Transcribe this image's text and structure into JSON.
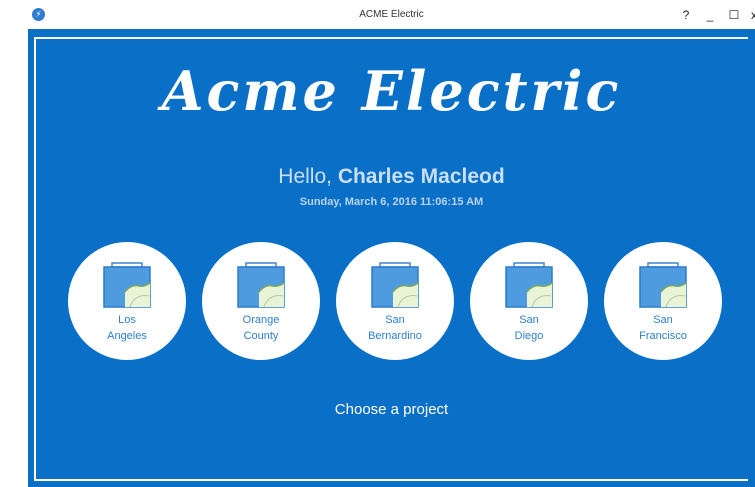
{
  "window": {
    "title": "ACME Electric",
    "controls": {
      "help": "?",
      "minimize": "_",
      "maximize": "☐",
      "close": "x"
    }
  },
  "main": {
    "brand": "Acme Electric",
    "greeting_prefix": "Hello, ",
    "user_name": "Charles Macleod",
    "datetime": "Sunday, March 6, 2016 11:06:15 AM",
    "projects": [
      {
        "label": "Los\nAngeles",
        "icon": "folder-map-icon"
      },
      {
        "label": "Orange\nCounty",
        "icon": "folder-map-icon"
      },
      {
        "label": "San\nBernardino",
        "icon": "folder-map-icon"
      },
      {
        "label": "San\nDiego",
        "icon": "folder-map-icon"
      },
      {
        "label": "San\nFrancisco",
        "icon": "folder-map-icon"
      }
    ],
    "choose_prompt": "Choose a project"
  },
  "colors": {
    "background": "#0a6fc7",
    "accent": "#2e80cf",
    "map_land": "#e9f3d6"
  }
}
